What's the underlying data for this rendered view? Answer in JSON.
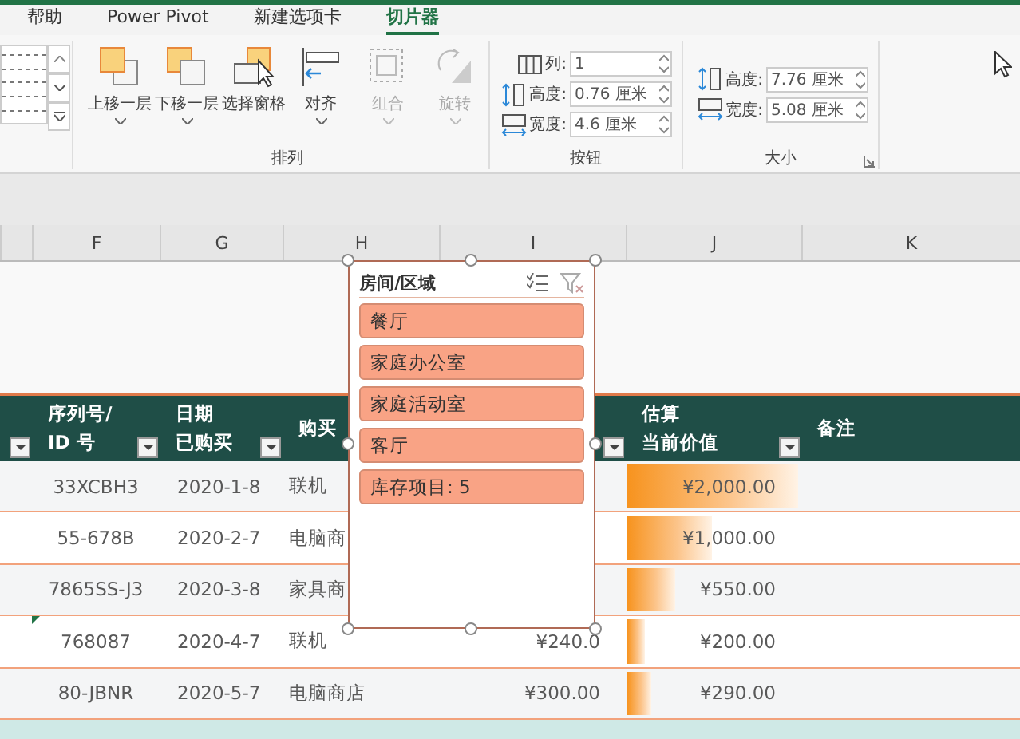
{
  "tabs": [
    {
      "label": "帮助",
      "selected": false
    },
    {
      "label": "Power Pivot",
      "selected": false
    },
    {
      "label": "新建选项卡",
      "selected": false
    },
    {
      "label": "切片器",
      "selected": true
    }
  ],
  "ribbon": {
    "arrange": {
      "label": "排列",
      "buttons": [
        {
          "label": "上移一层",
          "kind": "bring-forward",
          "dropdown": true,
          "disabled": false
        },
        {
          "label": "下移一层",
          "kind": "send-backward",
          "dropdown": true,
          "disabled": false
        },
        {
          "label": "选择窗格",
          "kind": "selection-pane",
          "dropdown": false,
          "disabled": false
        },
        {
          "label": "对齐",
          "kind": "align",
          "dropdown": true,
          "disabled": false
        },
        {
          "label": "组合",
          "kind": "group",
          "dropdown": true,
          "disabled": true
        },
        {
          "label": "旋转",
          "kind": "rotate",
          "dropdown": true,
          "disabled": true
        }
      ]
    },
    "buttons_group": {
      "label": "按钮",
      "fields": [
        {
          "kind": "columns",
          "label": "列:",
          "value": "1"
        },
        {
          "kind": "height",
          "label": "高度:",
          "value": "0.76 厘米"
        },
        {
          "kind": "width",
          "label": "宽度:",
          "value": "4.6 厘米"
        }
      ]
    },
    "size_group": {
      "label": "大小",
      "fields": [
        {
          "kind": "height",
          "label": "高度:",
          "value": "7.76 厘米"
        },
        {
          "kind": "width",
          "label": "宽度:",
          "value": "5.08 厘米"
        }
      ]
    }
  },
  "sheet": {
    "column_headers": [
      "F",
      "G",
      "H",
      "I",
      "J",
      "K"
    ],
    "table_header": [
      {
        "filter": true
      },
      {
        "lines": [
          "序列号/",
          "ID 号"
        ],
        "filter": true
      },
      {
        "lines": [
          "日期",
          "已购买"
        ],
        "filter": true
      },
      {
        "lines": [
          "购买"
        ],
        "filter": false
      },
      {
        "filter": true
      },
      {
        "lines": [
          "估算",
          "当前价值"
        ],
        "filter": true
      },
      {
        "lines": [
          "备注"
        ],
        "filter": false
      }
    ],
    "rows": [
      {
        "serial": "33XCBH3",
        "date": "2020-1-8",
        "vendor": "联机",
        "value": "¥2,000.00",
        "flag": false
      },
      {
        "serial": "55-678B",
        "date": "2020-2-7",
        "vendor": "电脑商",
        "value": "¥1,000.00",
        "flag": false
      },
      {
        "serial": "7865SS-J3",
        "date": "2020-3-8",
        "vendor": "家具商",
        "value": "¥550.00",
        "flag": false
      },
      {
        "serial": "768087",
        "date": "2020-4-7",
        "vendor": "联机",
        "column_4": "¥240.0",
        "value": "¥200.00",
        "flag": true
      },
      {
        "serial": "80-JBNR",
        "date": "2020-5-7",
        "vendor": "电脑商店",
        "column_4": "¥300.00",
        "value": "¥290.00",
        "flag": false
      }
    ]
  },
  "slicer": {
    "title": "房间/区域",
    "items": [
      {
        "label": "餐厅",
        "selected": true
      },
      {
        "label": "家庭办公室",
        "selected": true
      },
      {
        "label": "家庭活动室",
        "selected": true
      },
      {
        "label": "客厅",
        "selected": true
      },
      {
        "label": "库存项目: 5",
        "selected": true
      }
    ]
  }
}
